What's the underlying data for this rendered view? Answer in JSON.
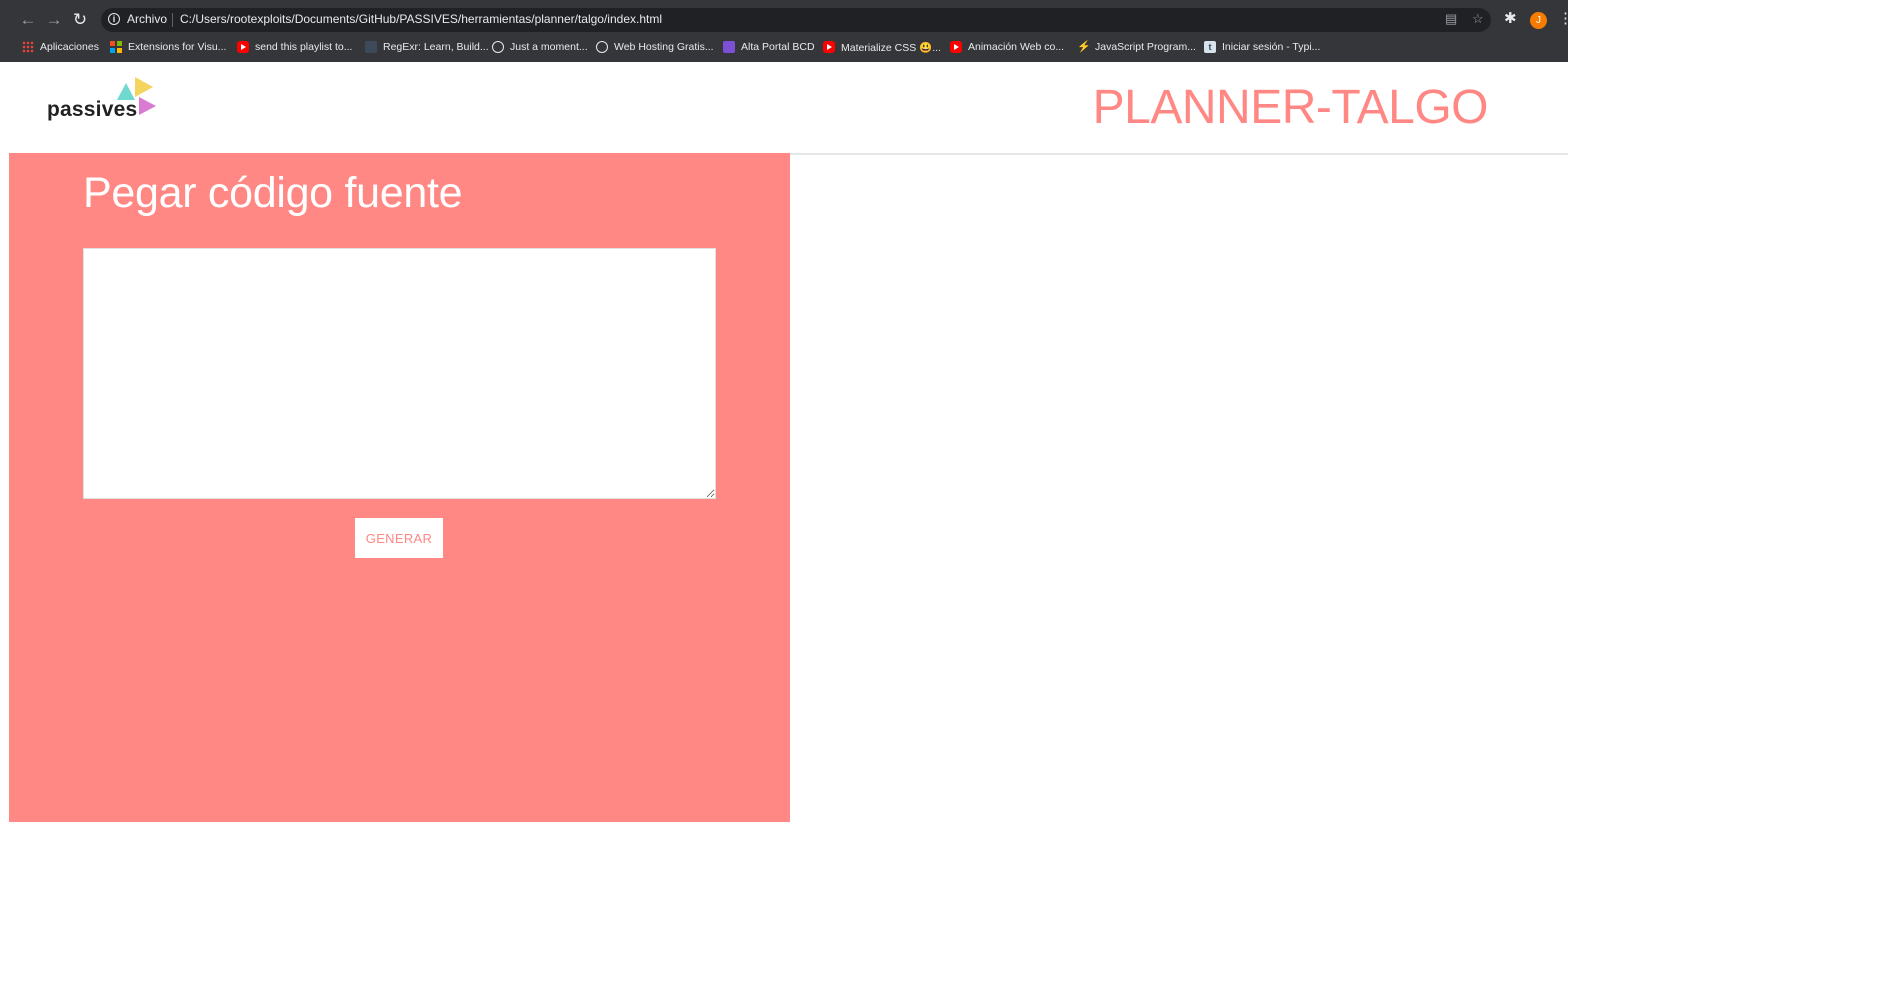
{
  "browser": {
    "url_scheme": "Archivo",
    "url": "C:/Users/rootexploits/Documents/GitHub/PASSIVES/herramientas/planner/talgo/index.html",
    "avatar_letter": "J",
    "bookmarks": [
      {
        "label": "Aplicaciones",
        "icon": "apps-grid-icon"
      },
      {
        "label": "Extensions for Visu...",
        "icon": "microsoft-icon"
      },
      {
        "label": "send this playlist to...",
        "icon": "youtube-icon"
      },
      {
        "label": "RegExr: Learn, Build...",
        "icon": "regexr-icon"
      },
      {
        "label": "Just a moment...",
        "icon": "globe-icon"
      },
      {
        "label": "Web Hosting Gratis...",
        "icon": "globe-icon"
      },
      {
        "label": "Alta Portal BCD",
        "icon": "list-icon"
      },
      {
        "label": "Materialize CSS 😃...",
        "icon": "youtube-icon"
      },
      {
        "label": "Animación Web co...",
        "icon": "youtube-icon"
      },
      {
        "label": "JavaScript Program...",
        "icon": "bolt-icon"
      },
      {
        "label": "Iniciar sesión - Typi...",
        "icon": "typing-icon"
      }
    ]
  },
  "header": {
    "logo_text": "passives",
    "title": "PLANNER-TALGO"
  },
  "main": {
    "panel_title": "Pegar código fuente",
    "textarea_value": "",
    "generate_label": "GENERAR"
  },
  "colors": {
    "accent": "#ff8784",
    "chrome_bg": "#35363a",
    "omnibox_bg": "#202124"
  }
}
